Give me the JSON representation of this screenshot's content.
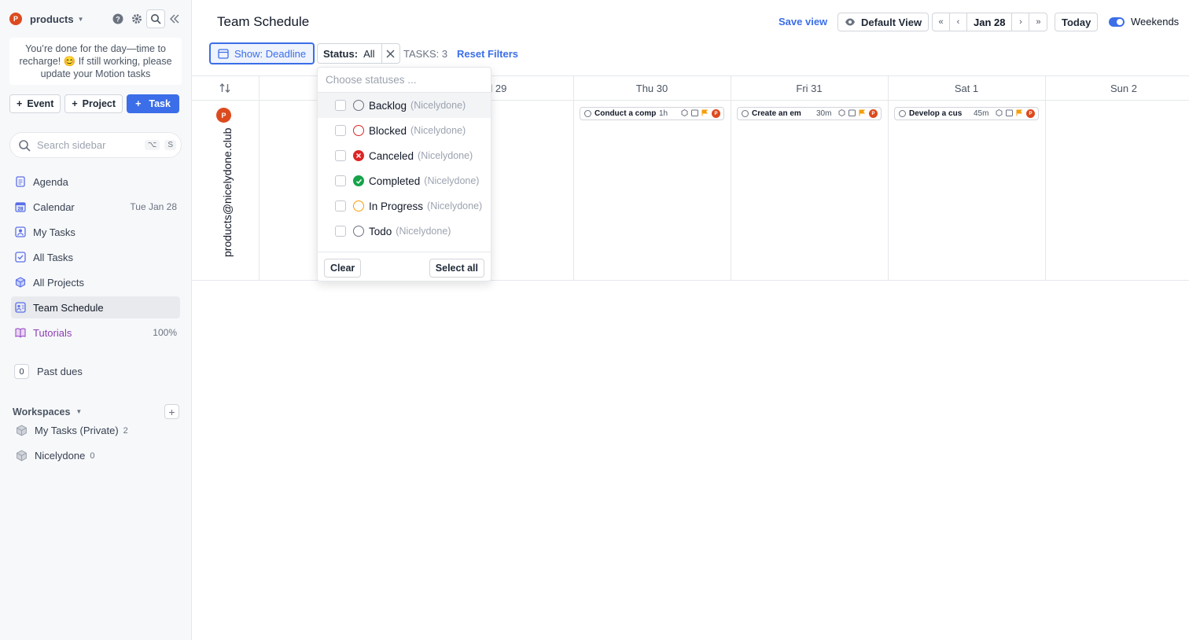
{
  "sidebar": {
    "workspace_avatar": "P",
    "workspace_name": "products",
    "notice": "You’re done for the day—time to recharge! 😊 If still working, please update your Motion tasks",
    "buttons": {
      "event": "Event",
      "project": "Project",
      "task": "Task"
    },
    "search": {
      "placeholder": "Search sidebar",
      "shortcut_1": "⌥",
      "shortcut_2": "S"
    },
    "nav": [
      {
        "label": "Agenda",
        "icon": "agenda-icon",
        "meta": ""
      },
      {
        "label": "Calendar",
        "icon": "calendar-icon",
        "meta": "Tue Jan 28"
      },
      {
        "label": "My Tasks",
        "icon": "user-icon",
        "meta": ""
      },
      {
        "label": "All Tasks",
        "icon": "checkbox-icon",
        "meta": ""
      },
      {
        "label": "All Projects",
        "icon": "cube-icon",
        "meta": ""
      },
      {
        "label": "Team Schedule",
        "icon": "team-schedule-icon",
        "meta": ""
      },
      {
        "label": "Tutorials",
        "icon": "book-icon",
        "meta": "100%"
      }
    ],
    "past_dues": {
      "count": "0",
      "label": "Past dues"
    },
    "workspaces": {
      "header": "Workspaces",
      "items": [
        {
          "label": "My Tasks (Private)",
          "count": "2"
        },
        {
          "label": "Nicelydone",
          "count": "0"
        }
      ]
    }
  },
  "header": {
    "title": "Team Schedule",
    "save_view": "Save view",
    "default_view": "Default View",
    "date": "Jan 28",
    "today": "Today",
    "weekends": "Weekends",
    "accent": "#3b6ee8"
  },
  "filters": {
    "show": "Show: Deadline",
    "status_label": "Status:",
    "status_value": "All",
    "tasks": "TASKS: 3",
    "reset": "Reset Filters"
  },
  "schedule": {
    "days": [
      "d 29",
      "Thu 30",
      "Fri 31",
      "Sat 1",
      "Sun 2"
    ],
    "user_avatar": "P",
    "user_email": "products@nicelydone.club",
    "tasks": [
      {
        "name": "Conduct a comp",
        "duration": "1h"
      },
      {
        "name": "Create an em",
        "duration": "30m"
      },
      {
        "name": "Develop a cus",
        "duration": "45m"
      }
    ]
  },
  "status_dropdown": {
    "placeholder": "Choose statuses ...",
    "options": [
      {
        "label": "Backlog",
        "workspace": "(Nicelydone)"
      },
      {
        "label": "Blocked",
        "workspace": "(Nicelydone)"
      },
      {
        "label": "Canceled",
        "workspace": "(Nicelydone)"
      },
      {
        "label": "Completed",
        "workspace": "(Nicelydone)"
      },
      {
        "label": "In Progress",
        "workspace": "(Nicelydone)"
      },
      {
        "label": "Todo",
        "workspace": "(Nicelydone)"
      }
    ],
    "clear": "Clear",
    "select_all": "Select all"
  }
}
